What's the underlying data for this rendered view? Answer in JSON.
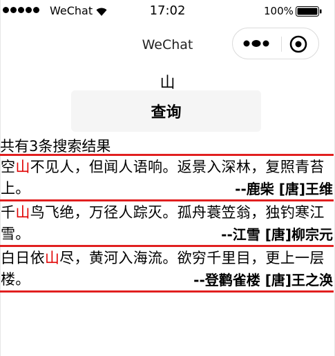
{
  "status_bar": {
    "carrier": "WeChat",
    "time": "17:02",
    "battery_percent": "100%"
  },
  "nav": {
    "title": "WeChat",
    "icons": [
      "more-dots-icon",
      "target-close-icon"
    ]
  },
  "search": {
    "keyword": "山",
    "button_label": "查询",
    "result_count_text": "共有3条搜索结果"
  },
  "results": [
    {
      "before": "空",
      "highlight": "山",
      "after": "不见人，但闻人语响。返景入深林，复照青苔上。",
      "meta": "--鹿柴 [唐]王维"
    },
    {
      "before": "千",
      "highlight": "山",
      "after": "鸟飞绝，万径人踪灭。孤舟蓑笠翁，独钓寒江雪。",
      "meta": "--江雪 [唐]柳宗元"
    },
    {
      "before": "白日依",
      "highlight": "山",
      "after": "尽，黄河入海流。欲穷千里目，更上一层楼。",
      "meta": "--登鹳雀楼 [唐]王之涣"
    }
  ],
  "colors": {
    "highlight": "#e00000",
    "divider": "#e11f1f",
    "button_bg": "#f5f5f5"
  }
}
